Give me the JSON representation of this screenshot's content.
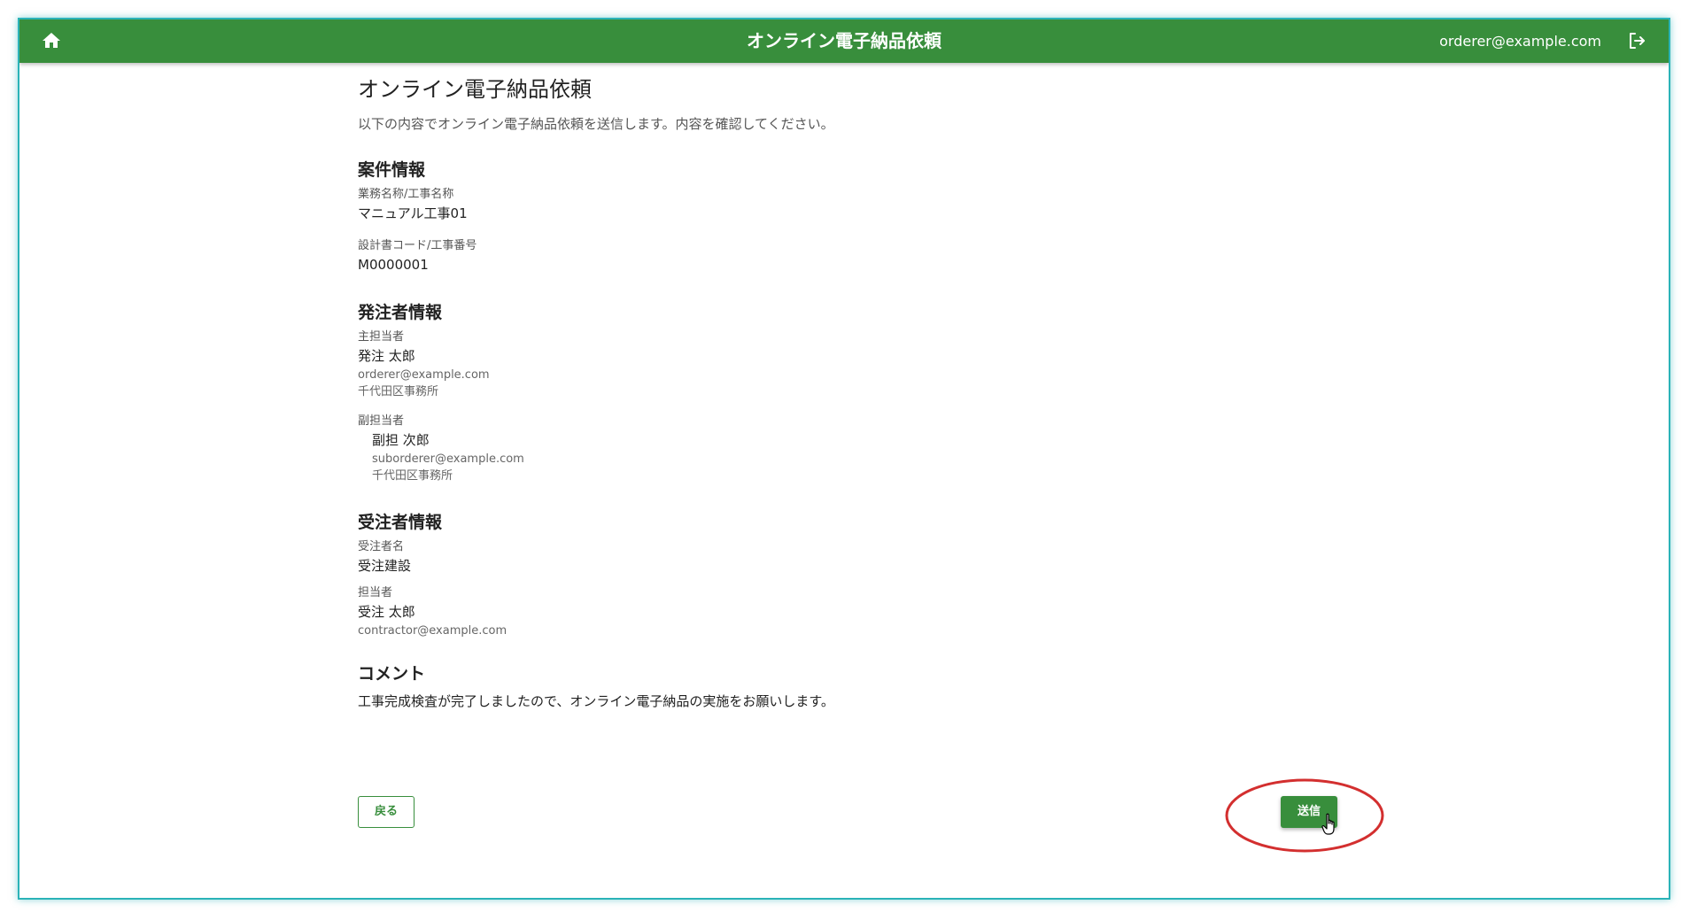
{
  "appbar": {
    "title": "オンライン電子納品依頼",
    "user_email": "orderer@example.com",
    "home_icon": "home-icon",
    "logout_icon": "logout-icon",
    "color": "#388e3c"
  },
  "page": {
    "title": "オンライン電子納品依頼",
    "intro": "以下の内容でオンライン電子納品依頼を送信します。内容を確認してください。"
  },
  "project": {
    "heading": "案件情報",
    "name_label": "業務名称/工事名称",
    "name_value": "マニュアル工事01",
    "code_label": "設計書コード/工事番号",
    "code_value": "M0000001"
  },
  "orderer": {
    "heading": "発注者情報",
    "main_label": "主担当者",
    "main_name": "発注 太郎",
    "main_email": "orderer@example.com",
    "main_office": "千代田区事務所",
    "sub_label": "副担当者",
    "sub_name": "副担 次郎",
    "sub_email": "suborderer@example.com",
    "sub_office": "千代田区事務所"
  },
  "contractor": {
    "heading": "受注者情報",
    "company_label": "受注者名",
    "company_value": "受注建設",
    "person_label": "担当者",
    "person_name": "受注 太郎",
    "person_email": "contractor@example.com"
  },
  "comment": {
    "heading": "コメント",
    "text": "工事完成検査が完了しましたので、オンライン電子納品の実施をお願いします。"
  },
  "actions": {
    "back_label": "戻る",
    "send_label": "送信"
  },
  "annotation": {
    "highlight_color": "#d32f2f",
    "cursor_icon": "hand-pointer-icon"
  }
}
